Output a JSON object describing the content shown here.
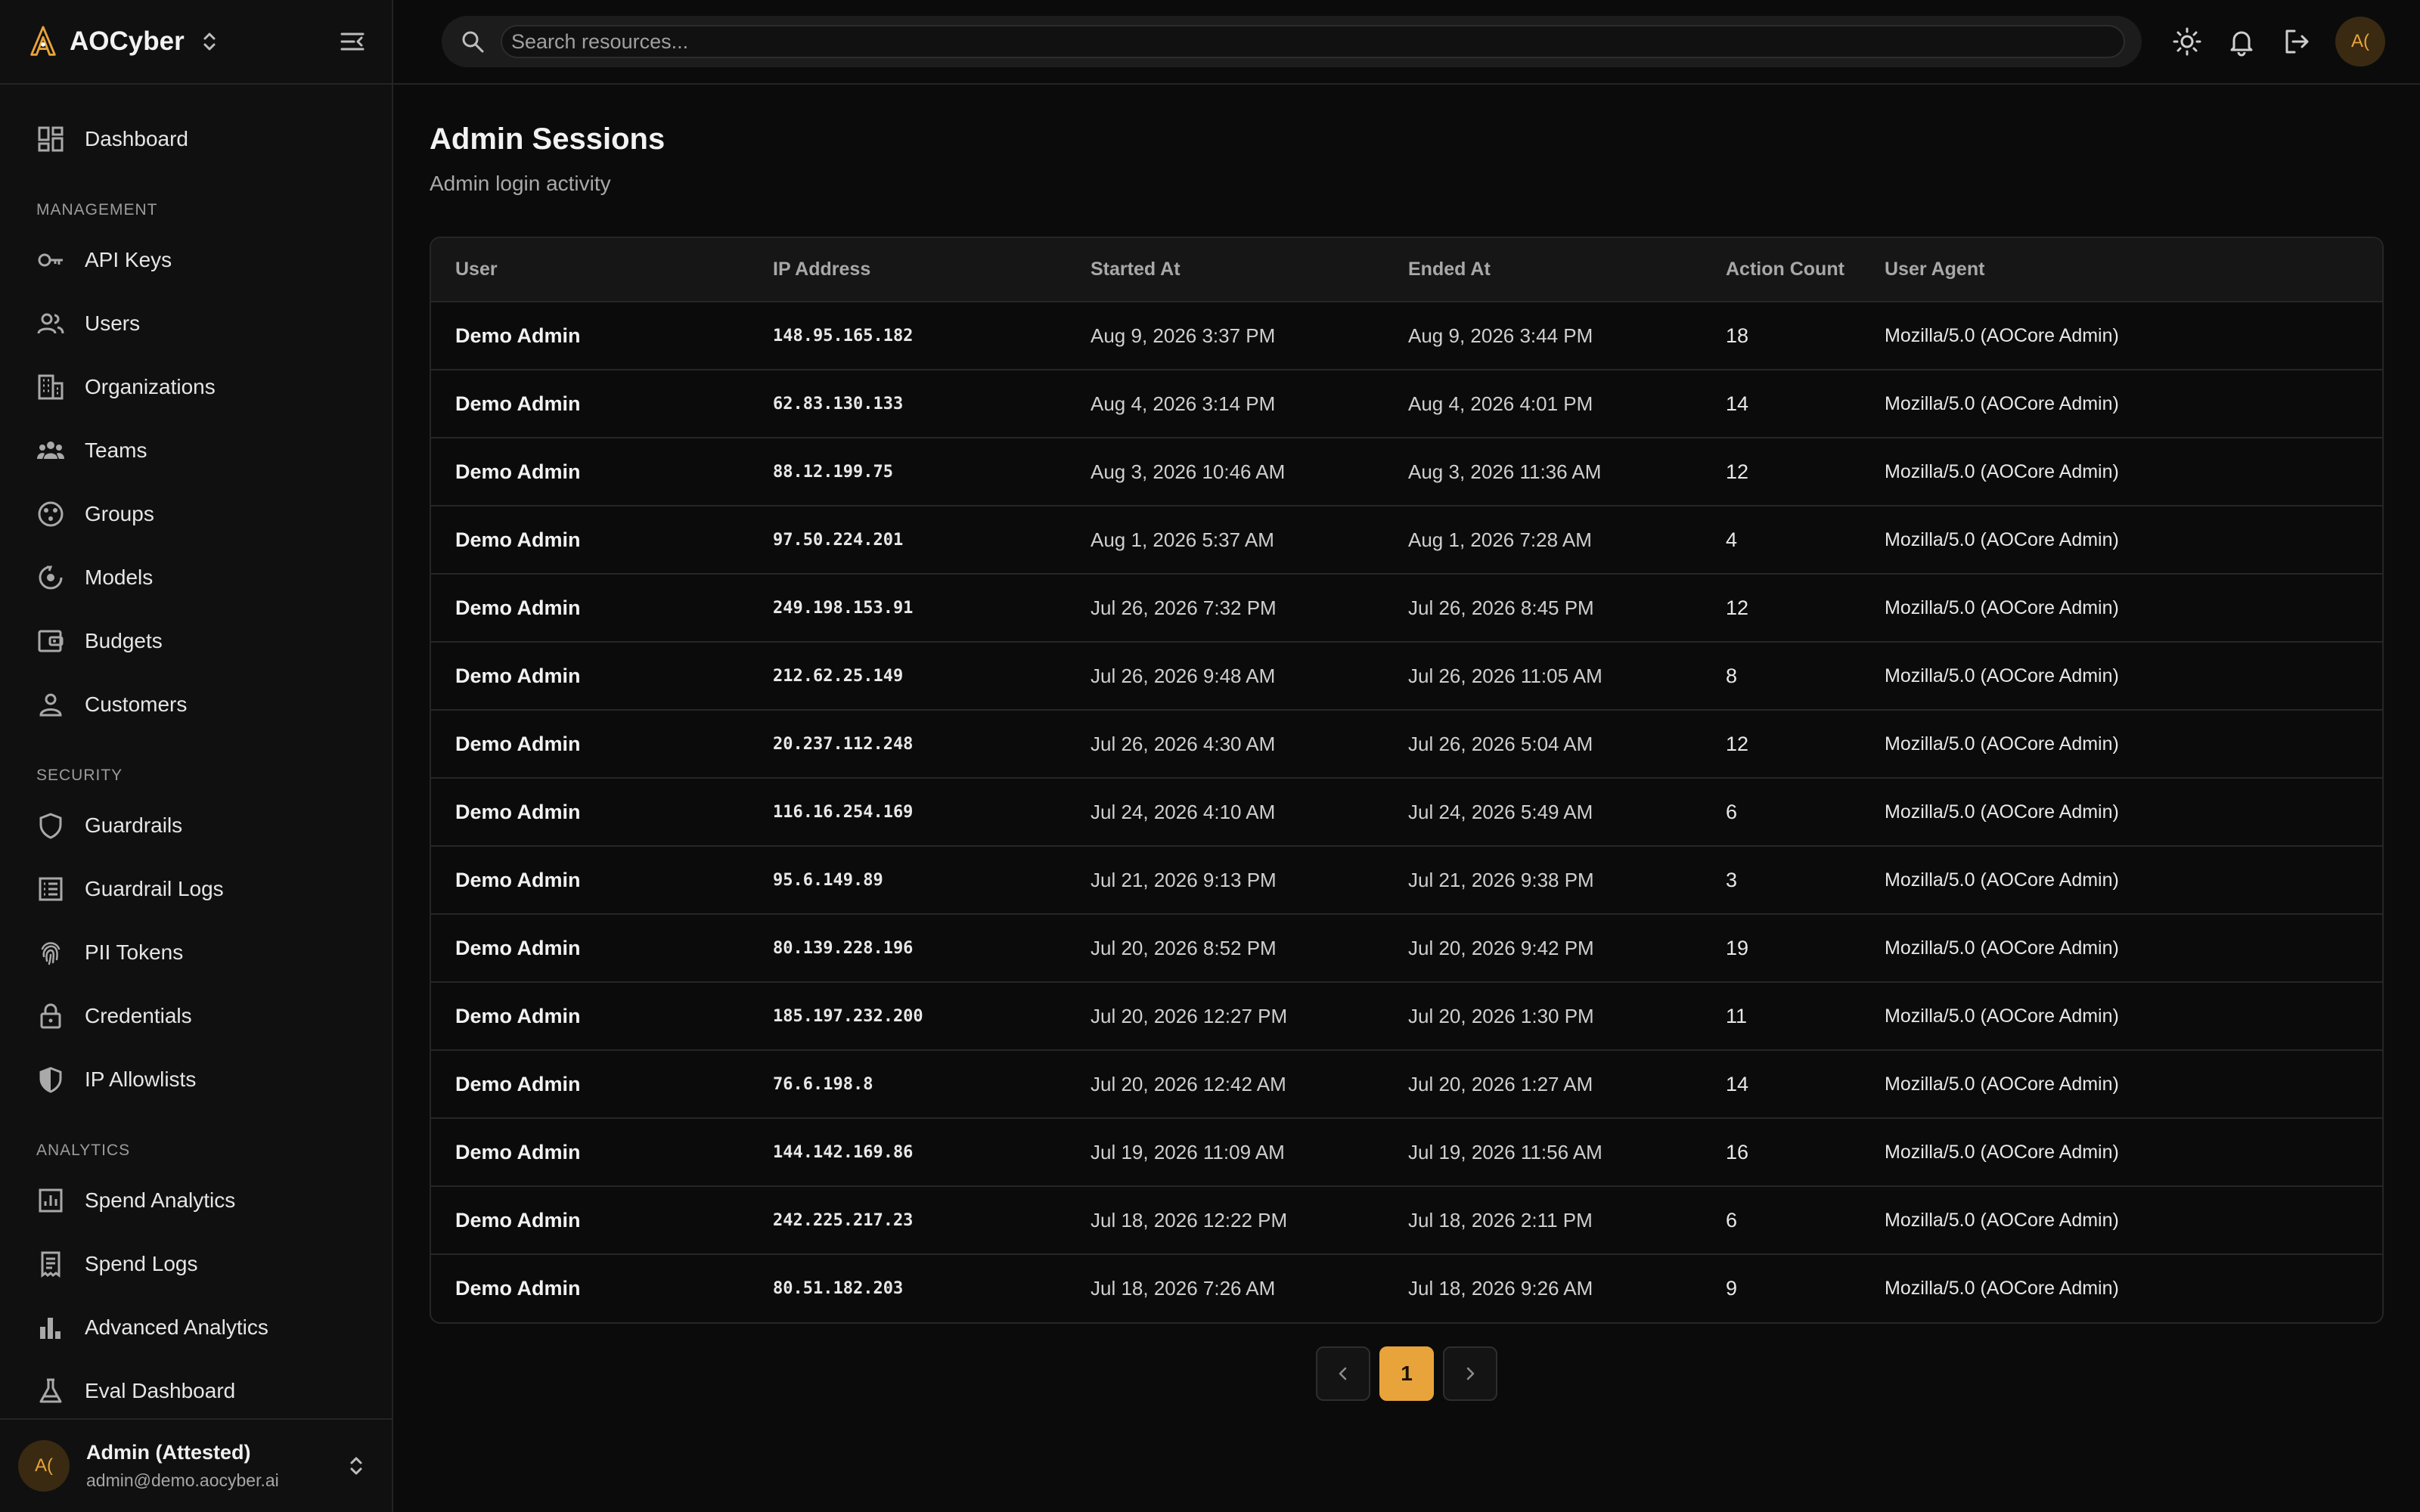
{
  "brand": {
    "name": "AOCyber"
  },
  "sidebar": {
    "top": [
      {
        "label": "Dashboard",
        "icon": "dashboard-icon"
      }
    ],
    "sections": [
      {
        "label": "MANAGEMENT",
        "items": [
          {
            "label": "API Keys",
            "icon": "key-icon"
          },
          {
            "label": "Users",
            "icon": "users-icon"
          },
          {
            "label": "Organizations",
            "icon": "building-icon"
          },
          {
            "label": "Teams",
            "icon": "team-icon"
          },
          {
            "label": "Groups",
            "icon": "groups-icon"
          },
          {
            "label": "Models",
            "icon": "model-icon"
          },
          {
            "label": "Budgets",
            "icon": "wallet-icon"
          },
          {
            "label": "Customers",
            "icon": "person-icon"
          }
        ]
      },
      {
        "label": "SECURITY",
        "items": [
          {
            "label": "Guardrails",
            "icon": "shield-icon"
          },
          {
            "label": "Guardrail Logs",
            "icon": "log-list-icon"
          },
          {
            "label": "PII Tokens",
            "icon": "fingerprint-icon"
          },
          {
            "label": "Credentials",
            "icon": "lock-icon"
          },
          {
            "label": "IP Allowlists",
            "icon": "shield-half-icon"
          }
        ]
      },
      {
        "label": "ANALYTICS",
        "items": [
          {
            "label": "Spend Analytics",
            "icon": "analytics-icon"
          },
          {
            "label": "Spend Logs",
            "icon": "receipt-icon"
          },
          {
            "label": "Advanced Analytics",
            "icon": "bar-chart-icon"
          },
          {
            "label": "Eval Dashboard",
            "icon": "flask-icon"
          }
        ]
      }
    ],
    "footer": {
      "initials": "A(",
      "name": "Admin (Attested)",
      "email": "admin@demo.aocyber.ai"
    }
  },
  "topbar": {
    "search_placeholder": "Search resources...",
    "avatar_initials": "A("
  },
  "page": {
    "title": "Admin Sessions",
    "subtitle": "Admin login activity"
  },
  "table": {
    "columns": [
      "User",
      "IP Address",
      "Started At",
      "Ended At",
      "Action Count",
      "User Agent"
    ],
    "rows": [
      [
        "Demo Admin",
        "148.95.165.182",
        "Aug 9, 2026 3:37 PM",
        "Aug 9, 2026 3:44 PM",
        "18",
        "Mozilla/5.0 (AOCore Admin)"
      ],
      [
        "Demo Admin",
        "62.83.130.133",
        "Aug 4, 2026 3:14 PM",
        "Aug 4, 2026 4:01 PM",
        "14",
        "Mozilla/5.0 (AOCore Admin)"
      ],
      [
        "Demo Admin",
        "88.12.199.75",
        "Aug 3, 2026 10:46 AM",
        "Aug 3, 2026 11:36 AM",
        "12",
        "Mozilla/5.0 (AOCore Admin)"
      ],
      [
        "Demo Admin",
        "97.50.224.201",
        "Aug 1, 2026 5:37 AM",
        "Aug 1, 2026 7:28 AM",
        "4",
        "Mozilla/5.0 (AOCore Admin)"
      ],
      [
        "Demo Admin",
        "249.198.153.91",
        "Jul 26, 2026 7:32 PM",
        "Jul 26, 2026 8:45 PM",
        "12",
        "Mozilla/5.0 (AOCore Admin)"
      ],
      [
        "Demo Admin",
        "212.62.25.149",
        "Jul 26, 2026 9:48 AM",
        "Jul 26, 2026 11:05 AM",
        "8",
        "Mozilla/5.0 (AOCore Admin)"
      ],
      [
        "Demo Admin",
        "20.237.112.248",
        "Jul 26, 2026 4:30 AM",
        "Jul 26, 2026 5:04 AM",
        "12",
        "Mozilla/5.0 (AOCore Admin)"
      ],
      [
        "Demo Admin",
        "116.16.254.169",
        "Jul 24, 2026 4:10 AM",
        "Jul 24, 2026 5:49 AM",
        "6",
        "Mozilla/5.0 (AOCore Admin)"
      ],
      [
        "Demo Admin",
        "95.6.149.89",
        "Jul 21, 2026 9:13 PM",
        "Jul 21, 2026 9:38 PM",
        "3",
        "Mozilla/5.0 (AOCore Admin)"
      ],
      [
        "Demo Admin",
        "80.139.228.196",
        "Jul 20, 2026 8:52 PM",
        "Jul 20, 2026 9:42 PM",
        "19",
        "Mozilla/5.0 (AOCore Admin)"
      ],
      [
        "Demo Admin",
        "185.197.232.200",
        "Jul 20, 2026 12:27 PM",
        "Jul 20, 2026 1:30 PM",
        "11",
        "Mozilla/5.0 (AOCore Admin)"
      ],
      [
        "Demo Admin",
        "76.6.198.8",
        "Jul 20, 2026 12:42 AM",
        "Jul 20, 2026 1:27 AM",
        "14",
        "Mozilla/5.0 (AOCore Admin)"
      ],
      [
        "Demo Admin",
        "144.142.169.86",
        "Jul 19, 2026 11:09 AM",
        "Jul 19, 2026 11:56 AM",
        "16",
        "Mozilla/5.0 (AOCore Admin)"
      ],
      [
        "Demo Admin",
        "242.225.217.23",
        "Jul 18, 2026 12:22 PM",
        "Jul 18, 2026 2:11 PM",
        "6",
        "Mozilla/5.0 (AOCore Admin)"
      ],
      [
        "Demo Admin",
        "80.51.182.203",
        "Jul 18, 2026 7:26 AM",
        "Jul 18, 2026 9:26 AM",
        "9",
        "Mozilla/5.0 (AOCore Admin)"
      ]
    ]
  },
  "pagination": {
    "current_page": "1"
  },
  "colors": {
    "accent": "#e8a43a",
    "background": "#0b0b0b",
    "sidebar": "#101010"
  }
}
